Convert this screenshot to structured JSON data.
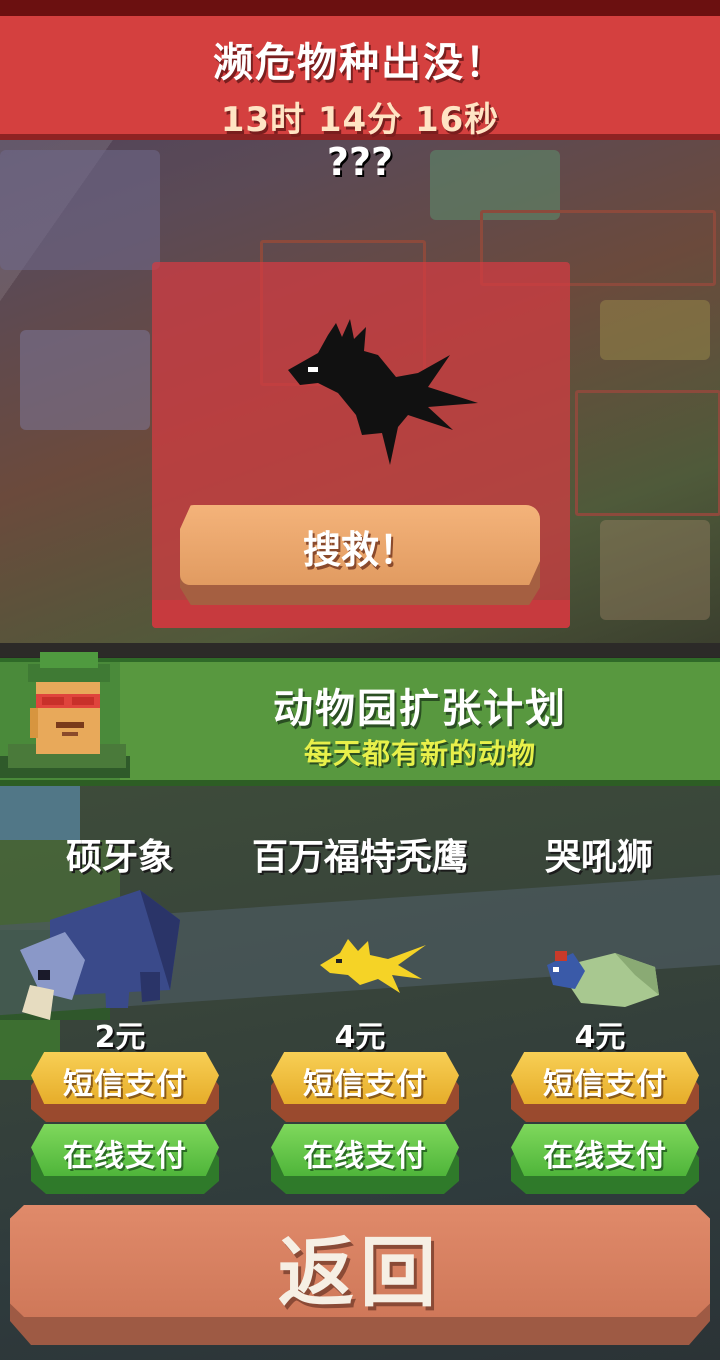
{
  "header": {
    "title": "濒危物种出没！",
    "timer": "13时 14分 16秒"
  },
  "mystery_label": "???",
  "rescue_button": "搜救！",
  "promo": {
    "title": "动物园扩张计划",
    "subtitle": "每天都有新的动物"
  },
  "animals": [
    {
      "name": "硕牙象",
      "price": "2元",
      "sms_label": "短信支付",
      "online_label": "在线支付"
    },
    {
      "name": "百万福特秃鹰",
      "price": "4元",
      "sms_label": "短信支付",
      "online_label": "在线支付"
    },
    {
      "name": "哭吼狮",
      "price": "4元",
      "sms_label": "短信支付",
      "online_label": "在线支付"
    }
  ],
  "back_button": "返回",
  "colors": {
    "header_red": "#d4403f",
    "promo_green": "#58983f",
    "sms_yellow": "#f0be3c",
    "online_green": "#5fc446",
    "back_salmon": "#d98163"
  }
}
